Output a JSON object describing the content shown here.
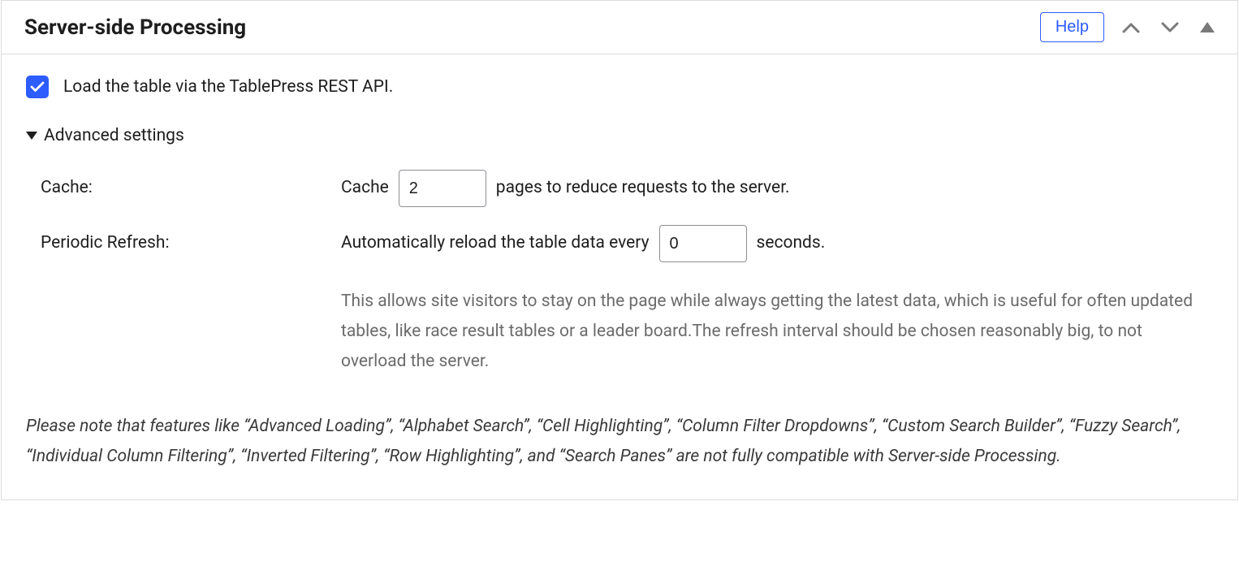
{
  "panel": {
    "title": "Server-side Processing",
    "help_label": "Help"
  },
  "checkbox": {
    "label": "Load the table via the TablePress REST API.",
    "checked": true
  },
  "advanced": {
    "summary": "Advanced settings",
    "cache": {
      "label": "Cache:",
      "prefix": "Cache",
      "value": "2",
      "suffix": "pages to reduce requests to the server."
    },
    "refresh": {
      "label": "Periodic Refresh:",
      "prefix": "Automatically reload the table data every",
      "value": "0",
      "suffix": "seconds.",
      "description": "This allows site visitors to stay on the page while always getting the latest data, which is useful for often updated tables, like race result tables or a leader board.The refresh interval should be chosen reasonably big, to not overload the server."
    }
  },
  "footer_note": "Please note that features like “Advanced Loading”, “Alphabet Search”, “Cell Highlighting”, “Column Filter Dropdowns”, “Custom Search Builder”, “Fuzzy Search”, “Individual Column Filtering”, “Inverted Filtering”, “Row Highlighting”, and “Search Panes” are not fully compatible with Server-side Processing."
}
